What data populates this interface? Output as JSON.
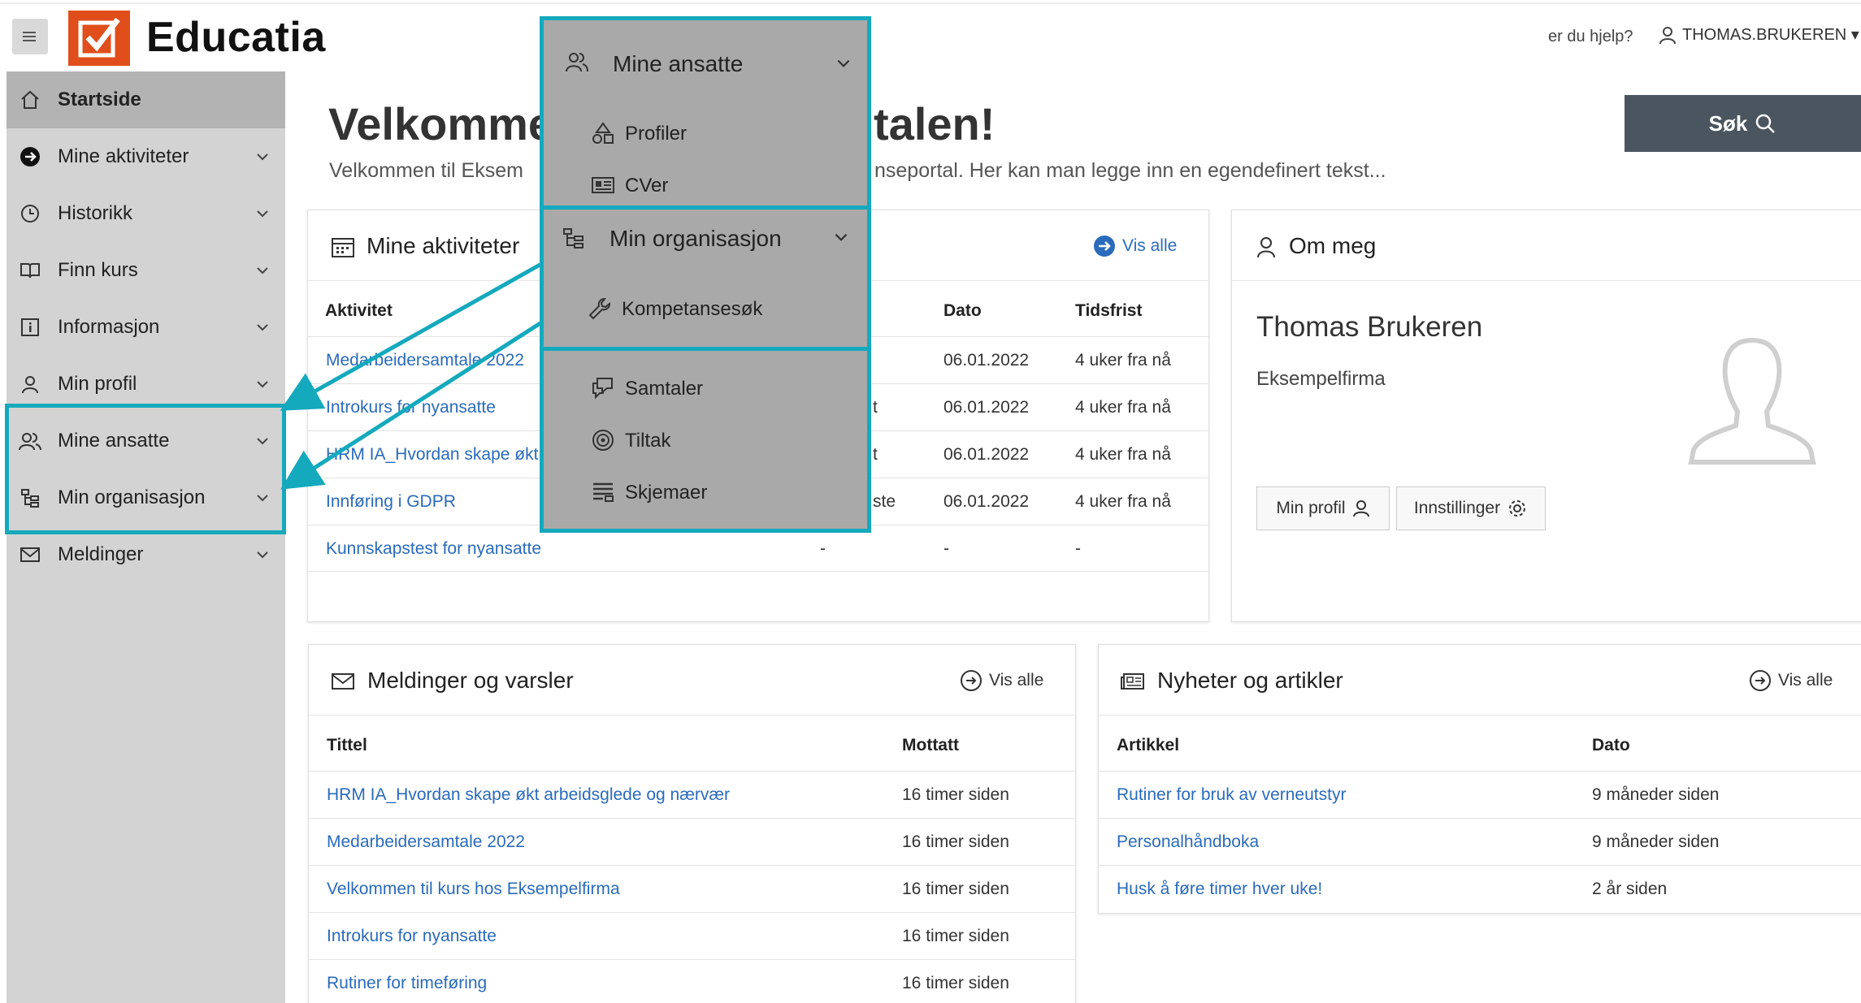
{
  "header": {
    "brand": "Educatia",
    "help_text": "er du hjelp?",
    "username": "THOMAS.BRUKEREN ▾"
  },
  "sidebar": {
    "items": [
      {
        "label": "Startside",
        "icon": "home-icon"
      },
      {
        "label": "Mine aktiviteter",
        "icon": "arrow-circle-icon"
      },
      {
        "label": "Historikk",
        "icon": "history-icon"
      },
      {
        "label": "Finn kurs",
        "icon": "book-icon"
      },
      {
        "label": "Informasjon",
        "icon": "info-icon"
      },
      {
        "label": "Min profil",
        "icon": "user-icon"
      },
      {
        "label": "Mine ansatte",
        "icon": "users-icon"
      },
      {
        "label": "Min organisasjon",
        "icon": "org-icon"
      },
      {
        "label": "Meldinger",
        "icon": "mail-icon"
      }
    ]
  },
  "page": {
    "title_left": "Velkomme",
    "title_right": "talen!",
    "subtitle_left": "Velkommen til Eksem",
    "subtitle_right": "nseportal. Her kan man legge inn en egendefinert tekst...",
    "search_label": "Søk"
  },
  "activities": {
    "title": "Mine aktiviteter",
    "vis_alle": "Vis alle",
    "headers": {
      "activity": "Aktivitet",
      "date": "Dato",
      "deadline": "Tidsfrist"
    },
    "rows": [
      {
        "name": "Medarbeidersamtale 2022",
        "mid": "",
        "date": "06.01.2022",
        "deadline": "4 uker fra nå"
      },
      {
        "name": "Introkurs for nyansatte",
        "mid": "t",
        "date": "06.01.2022",
        "deadline": "4 uker fra nå"
      },
      {
        "name": "HRM IA_Hvordan skape økt",
        "mid": "t",
        "date": "06.01.2022",
        "deadline": "4 uker fra nå"
      },
      {
        "name": "Innføring i GDPR",
        "mid": "ste",
        "date": "06.01.2022",
        "deadline": "4 uker fra nå"
      },
      {
        "name": "Kunnskapstest for nyansatte",
        "mid": "-",
        "date": "-",
        "deadline": "-"
      }
    ]
  },
  "about": {
    "title": "Om meg",
    "name": "Thomas Brukeren",
    "company": "Eksempelfirma",
    "profile_button": "Min profil",
    "settings_button": "Innstillinger"
  },
  "messages": {
    "title": "Meldinger og varsler",
    "vis_alle": "Vis alle",
    "headers": {
      "title": "Tittel",
      "received": "Mottatt"
    },
    "rows": [
      {
        "title": "HRM IA_Hvordan skape økt arbeidsglede og nærvær",
        "received": "16 timer siden"
      },
      {
        "title": "Medarbeidersamtale 2022",
        "received": "16 timer siden"
      },
      {
        "title": "Velkommen til kurs hos Eksempelfirma",
        "received": "16 timer siden"
      },
      {
        "title": "Introkurs for nyansatte",
        "received": "16 timer siden"
      },
      {
        "title": "Rutiner for timeføring",
        "received": "16 timer siden"
      }
    ]
  },
  "news": {
    "title": "Nyheter og artikler",
    "vis_alle": "Vis alle",
    "headers": {
      "article": "Artikkel",
      "date": "Dato"
    },
    "rows": [
      {
        "title": "Rutiner for bruk av verneutstyr",
        "date": "9 måneder siden"
      },
      {
        "title": "Personalhåndboka",
        "date": "9 måneder siden"
      },
      {
        "title": "Husk å føre timer hver uke!",
        "date": "2 år siden"
      }
    ]
  },
  "overlay": {
    "ansatte": {
      "title": "Mine ansatte",
      "items": [
        "Profiler",
        "CVer"
      ]
    },
    "organisasjon": {
      "title": "Min organisasjon",
      "items": [
        "Kompetansesøk"
      ]
    },
    "other": {
      "items": [
        "Samtaler",
        "Tiltak",
        "Skjemaer"
      ]
    }
  },
  "colors": {
    "accent": "#15a9bd",
    "brand": "#e04e1b",
    "link": "#2a6bbb",
    "sidebar": "#d3d3d3"
  }
}
